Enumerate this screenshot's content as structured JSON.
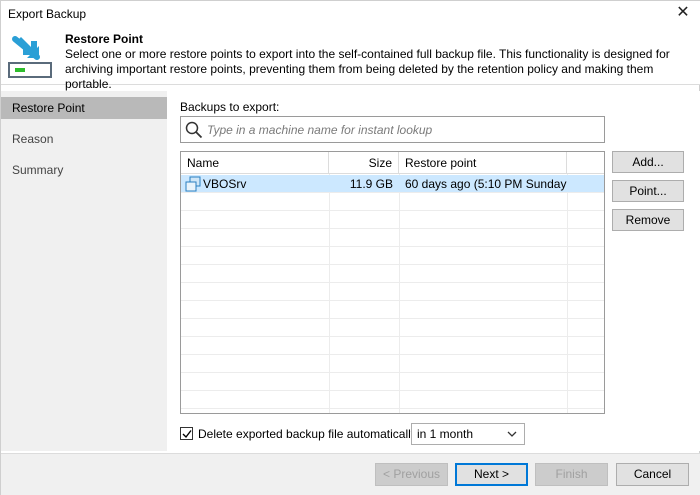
{
  "window": {
    "title": "Export Backup",
    "close_glyph": "✕"
  },
  "header": {
    "title": "Restore Point",
    "description": "Select one or more restore points to export into the self-contained full backup file. This functionality is designed for archiving important restore points, preventing them from being deleted by the retention policy and making them portable.",
    "icon": "export-wizard-icon"
  },
  "sidebar": {
    "steps": [
      {
        "label": "Restore Point",
        "active": true
      },
      {
        "label": "Reason",
        "active": false
      },
      {
        "label": "Summary",
        "active": false
      }
    ]
  },
  "main": {
    "backups_label": "Backups to export:",
    "search_placeholder": "Type in a machine name for instant lookup",
    "table": {
      "columns": [
        "Name",
        "Size",
        "Restore point"
      ],
      "rows": [
        {
          "name": "VBOSrv",
          "size": "11.9 GB",
          "restore_point": "60 days ago (5:10 PM Sunday ...",
          "selected": true,
          "icon": "vm-icon"
        }
      ]
    },
    "buttons": {
      "add": "Add...",
      "point": "Point...",
      "remove": "Remove"
    },
    "delete_option": {
      "label": "Delete exported backup file automatically",
      "checked": true,
      "period": "in 1 month"
    }
  },
  "footer": {
    "previous": "< Previous",
    "next": "Next >",
    "finish": "Finish",
    "cancel": "Cancel"
  },
  "colors": {
    "accent": "#0078d7",
    "selection": "#cce8ff",
    "sidebar_active": "#b9b9b9"
  }
}
